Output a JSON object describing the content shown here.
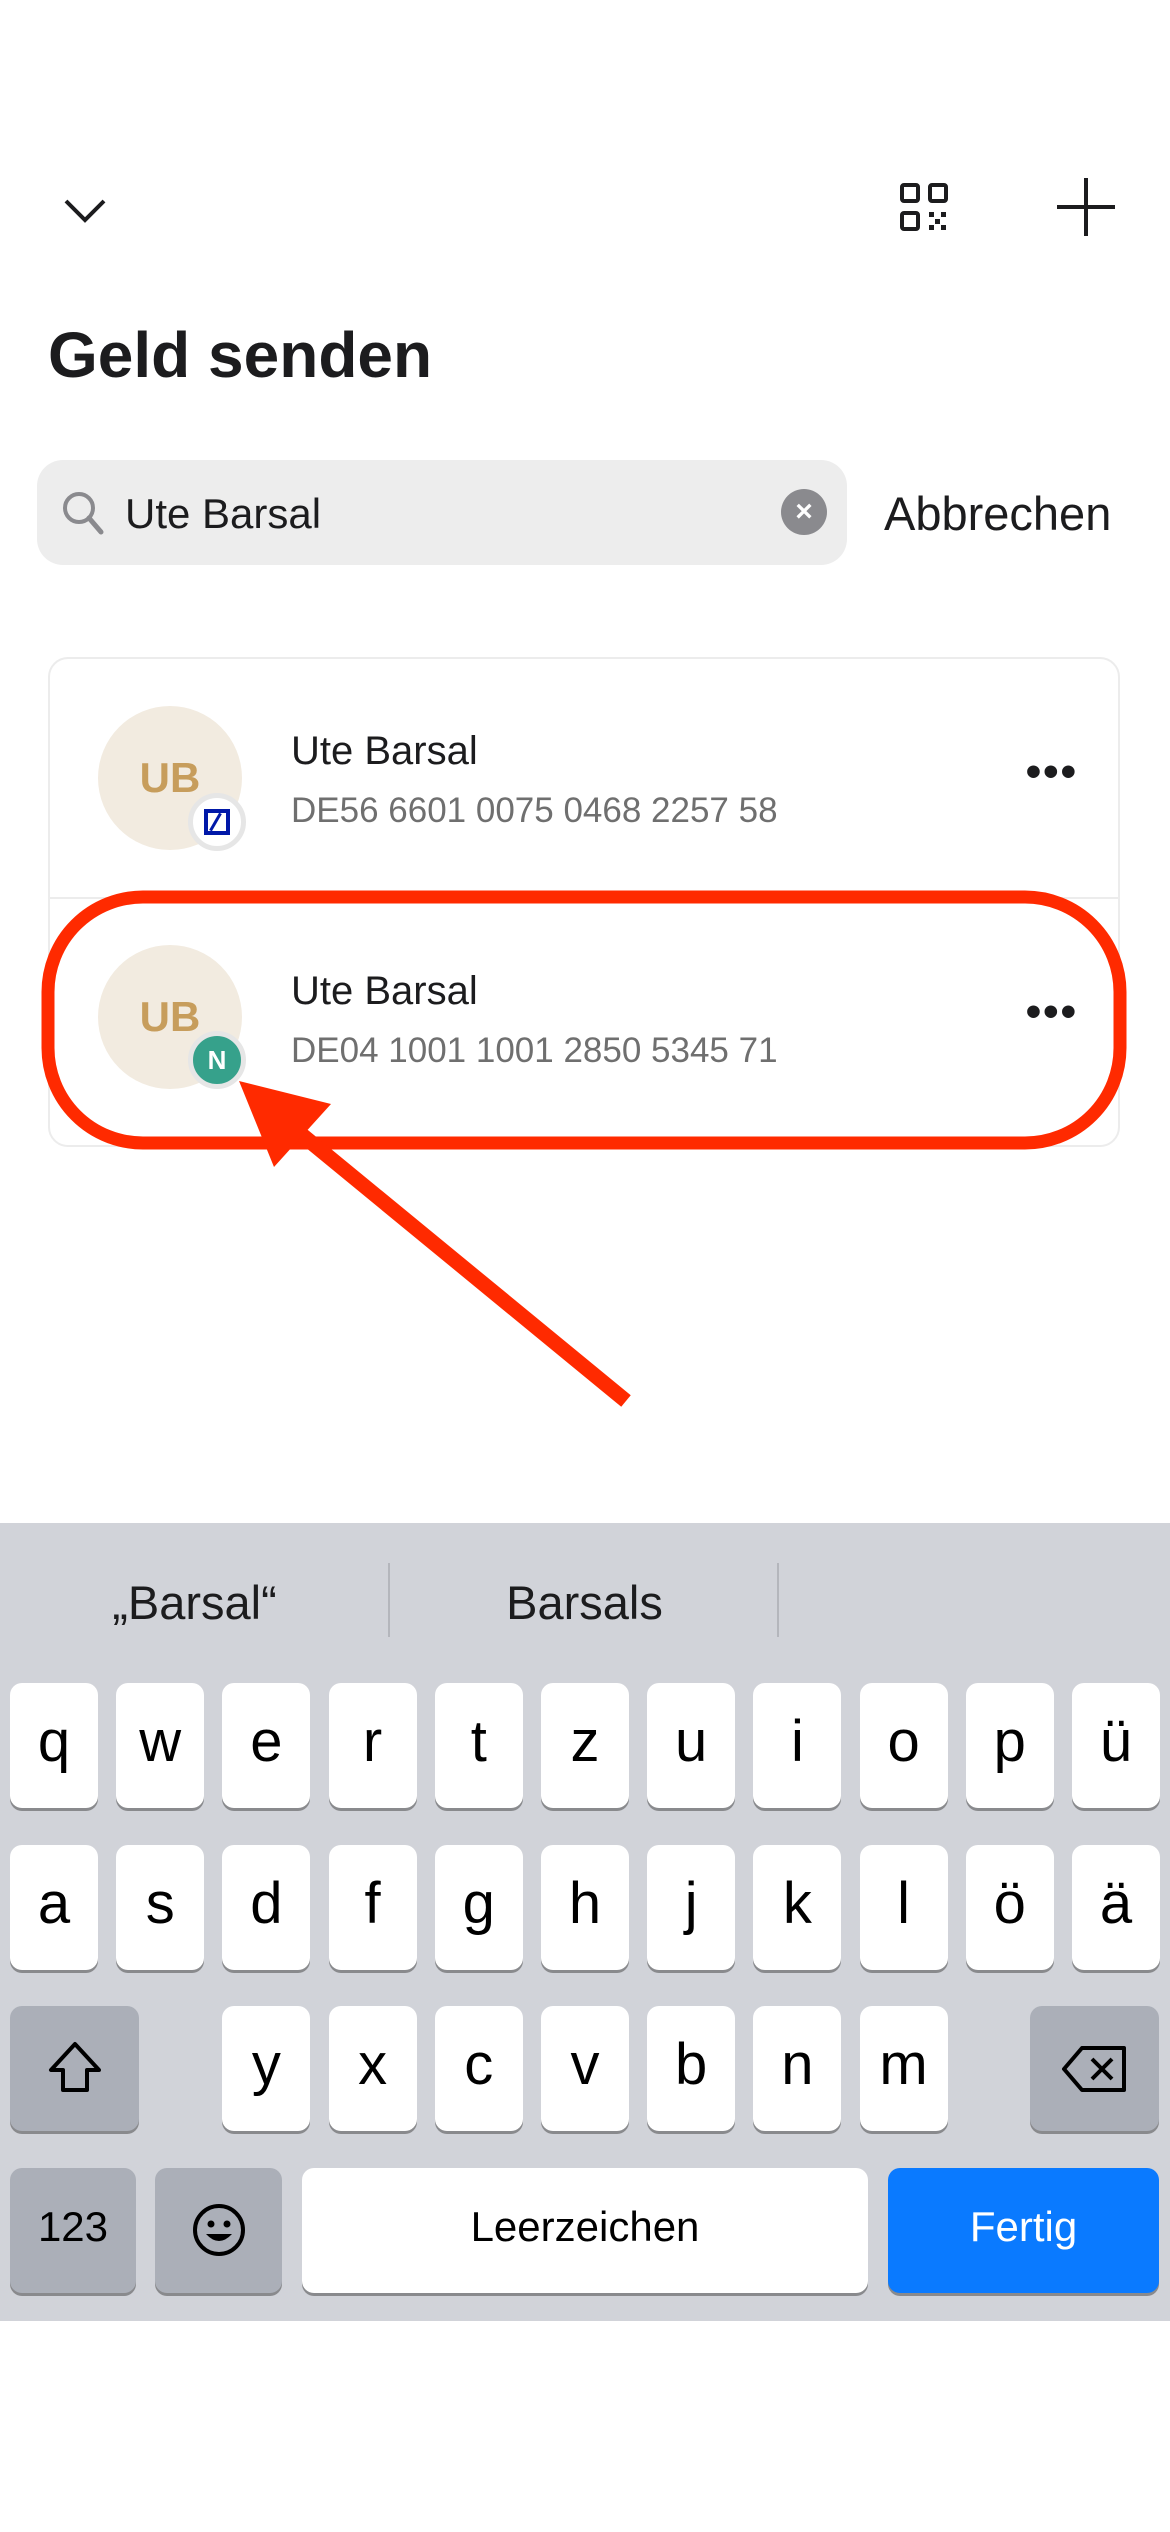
{
  "header": {
    "title": "Geld senden"
  },
  "search": {
    "value": "Ute Barsal",
    "cancel": "Abbrechen"
  },
  "results": [
    {
      "initials": "UB",
      "name": "Ute Barsal",
      "iban": "DE56 6601 0075 0468 2257 58",
      "bank_icon": "deutsche-bank-icon",
      "more": "•••"
    },
    {
      "initials": "UB",
      "name": "Ute Barsal",
      "iban": "DE04 1001 1001 2850 5345 71",
      "bank_icon": "n26-icon",
      "more": "•••"
    }
  ],
  "keyboard": {
    "suggestions": [
      "„Barsal“",
      "Barsals",
      ""
    ],
    "row1": [
      "q",
      "w",
      "e",
      "r",
      "t",
      "z",
      "u",
      "i",
      "o",
      "p",
      "ü"
    ],
    "row2": [
      "a",
      "s",
      "d",
      "f",
      "g",
      "h",
      "j",
      "k",
      "l",
      "ö",
      "ä"
    ],
    "row3": [
      "y",
      "x",
      "c",
      "v",
      "b",
      "n",
      "m"
    ],
    "numbers": "123",
    "space": "Leerzeichen",
    "done": "Fertig"
  },
  "colors": {
    "highlight": "#ff2a00",
    "done": "#0a7aff",
    "avatar_text": "#c79d5c"
  }
}
